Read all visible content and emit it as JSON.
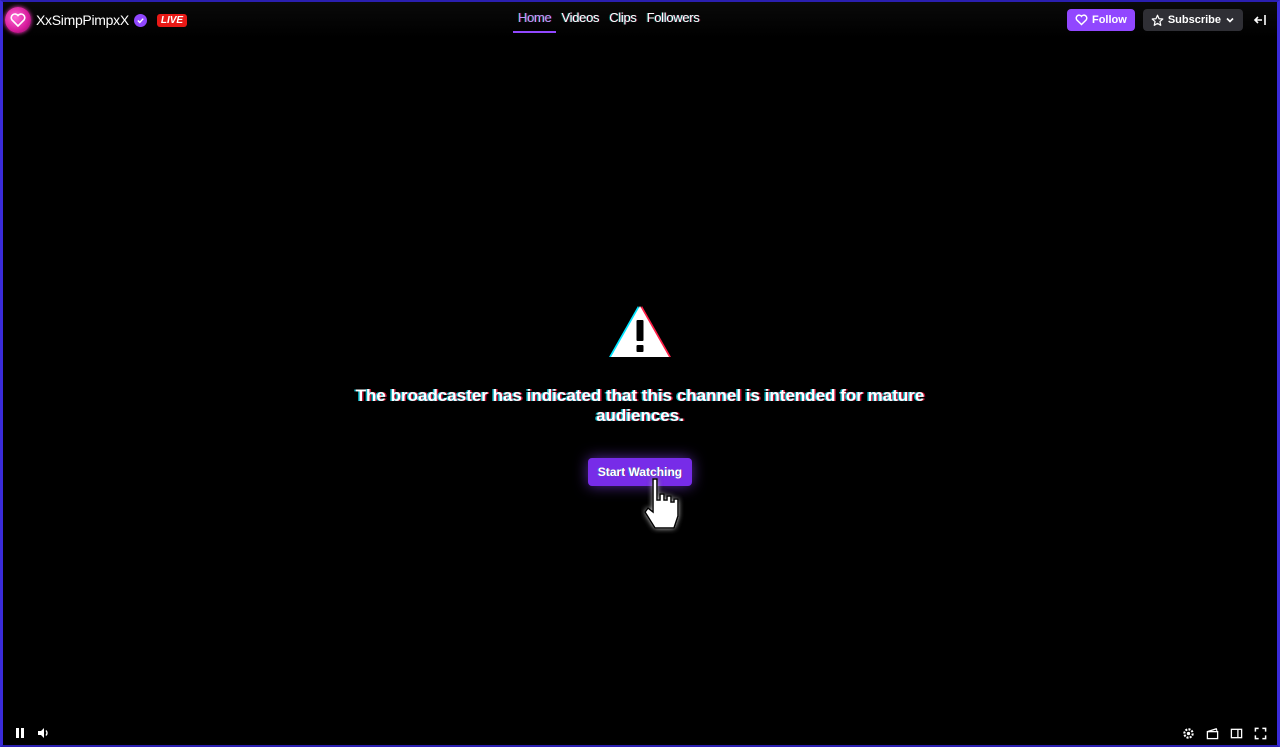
{
  "header": {
    "channel_name": "XxSimpPimpxX",
    "live_label": "LIVE",
    "tabs": [
      {
        "label": "Home",
        "active": true
      },
      {
        "label": "Videos",
        "active": false
      },
      {
        "label": "Clips",
        "active": false
      },
      {
        "label": "Followers",
        "active": false
      }
    ],
    "follow_label": "Follow",
    "subscribe_label": "Subscribe"
  },
  "gate": {
    "message": "The broadcaster has indicated that this channel is intended for mature audiences.",
    "button_label": "Start Watching"
  },
  "colors": {
    "accent": "#9147ff",
    "button": "#772ce8",
    "live": "#e91916",
    "frame_border": "#3a2bd9"
  },
  "icons": {
    "avatar": "heart-avatar-icon",
    "verified": "verified-badge-icon",
    "follow": "heart-outline-icon",
    "subscribe": "star-outline-icon",
    "subscribe_menu": "chevron-down-icon",
    "collapse": "collapse-arrow-icon",
    "warning": "warning-triangle-icon",
    "cursor": "hand-pointer-cursor-icon",
    "pause": "pause-icon",
    "volume": "volume-icon",
    "settings": "gear-icon",
    "clip": "clapperboard-icon",
    "theatre": "theatre-mode-icon",
    "fullscreen": "fullscreen-icon"
  }
}
